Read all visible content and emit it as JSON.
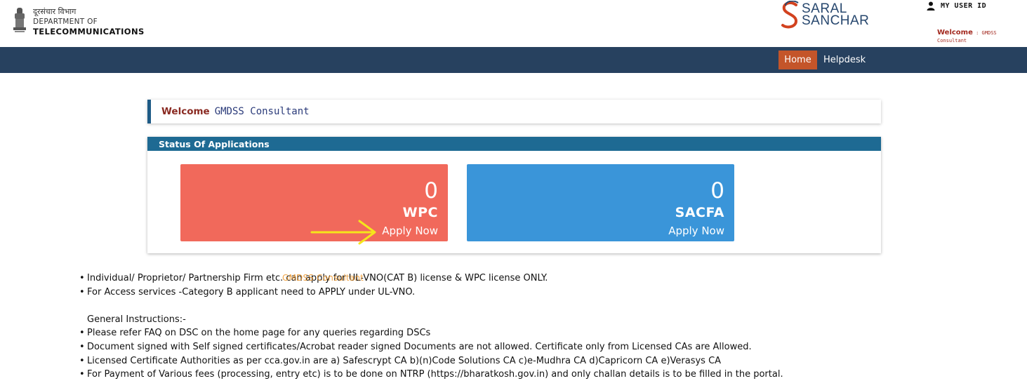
{
  "header": {
    "dept_hindi": "दूरसंचार विभाग",
    "dept_line2": "DEPARTMENT OF",
    "dept_line3": "TELECOMMUNICATIONS",
    "logo_line1": "SARAL",
    "logo_line2": "SANCHAR",
    "user_id_label": "MY USER ID",
    "welcome_label": "Welcome",
    "welcome_sep": " : ",
    "welcome_name": "GMDSS Consultant"
  },
  "nav": {
    "home": "Home",
    "helpdesk": "Helpdesk"
  },
  "welcome_box": {
    "label": "Welcome",
    "name": "GMDSS Consultant"
  },
  "status": {
    "title": "Status Of Applications",
    "cards": [
      {
        "count": "0",
        "label": "WPC",
        "apply": "Apply Now",
        "color": "#f1695b"
      },
      {
        "count": "0",
        "label": "SACFA",
        "apply": "Apply Now",
        "color": "#3a95d9"
      }
    ]
  },
  "watermark": "GMDSS Consultant",
  "instructions": {
    "top": [
      "Individual/ Proprietor/ Partnership Firm etc. can apply for UL-VNO(CAT B) license & WPC license ONLY.",
      "For Access services -Category B applicant need to APPLY under UL-VNO."
    ],
    "general_title": "General Instructions:-",
    "general": [
      "Please refer FAQ on DSC on the home page for any queries regarding DSCs",
      "Document signed with Self signed certificates/Acrobat reader signed Documents are not allowed. Certificate only from Licensed CAs are Allowed.",
      "Licensed Certificate Authorities as per cca.gov.in are a) Safescrypt CA b)(n)Code Solutions CA c)e-Mudhra CA d)Capricorn CA e)Verasys CA",
      "For Payment of Various fees (processing, entry etc) is to be done on NTRP (https://bharatkosh.gov.in) and only challan details is to be filled in the portal."
    ]
  },
  "colors": {
    "navbar": "#27415f",
    "home_active": "#c4552a",
    "status_header": "#1e6a93",
    "wpc_card": "#f1695b",
    "sacfa_card": "#3a95d9",
    "welcome_accent": "#8a2a22",
    "annotation_arrow": "#f5e51b"
  },
  "icons": {
    "emblem": "national-emblem-icon",
    "user": "user-icon",
    "logo_mark": "saral-sanchar-s-logo",
    "arrow": "annotation-arrow-icon"
  }
}
